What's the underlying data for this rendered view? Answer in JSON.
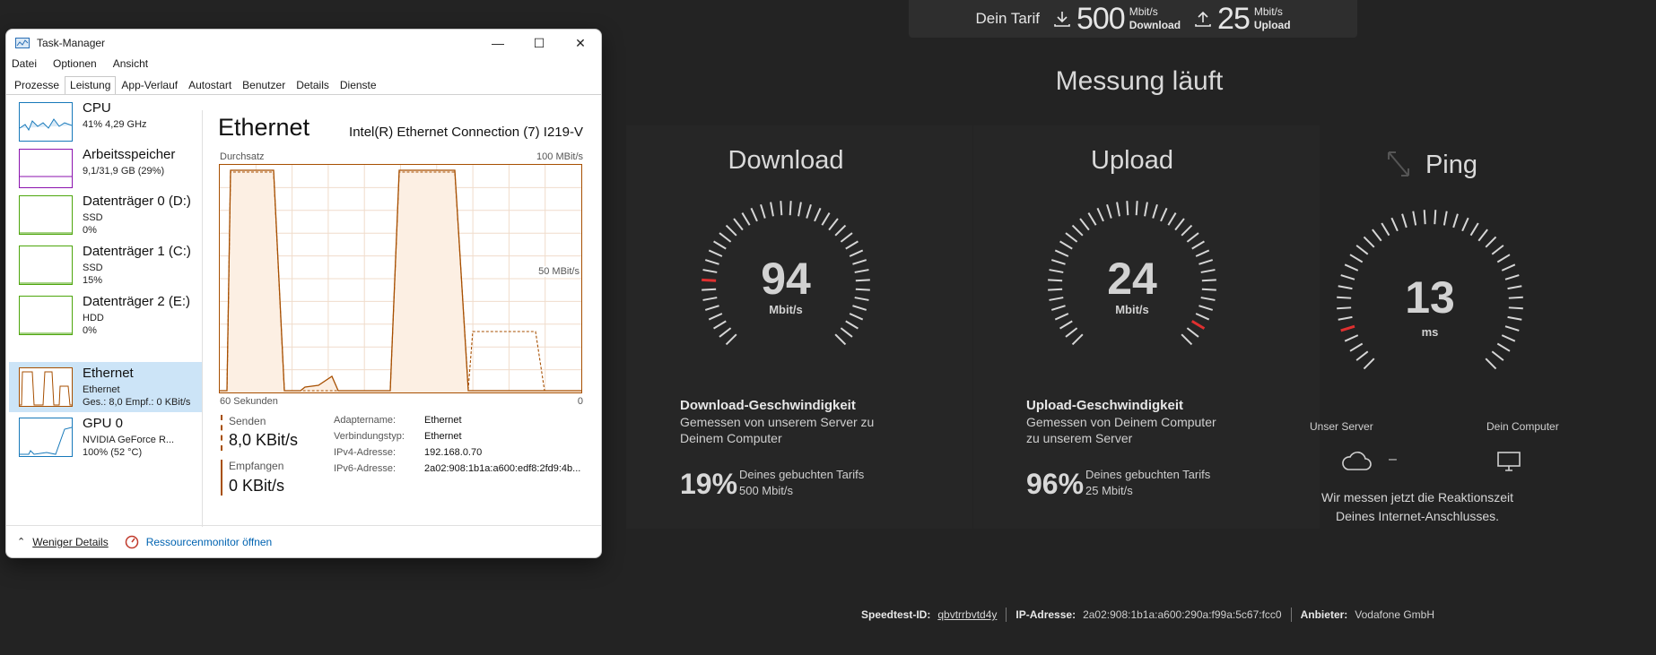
{
  "speedtest": {
    "tarif": {
      "label": "Dein Tarif",
      "download_value": "500",
      "download_unit": "Mbit/s",
      "download_label": "Download",
      "upload_value": "25",
      "upload_unit": "Mbit/s",
      "upload_label": "Upload"
    },
    "heading": "Messung läuft",
    "download": {
      "title": "Download",
      "value": "94",
      "unit": "Mbit/s",
      "desc_title": "Download-Geschwindigkeit",
      "desc_text": "Gemessen von unserem Server zu Deinem Computer",
      "percent": "19%",
      "percent_text1": "Deines gebuchten Tarifs",
      "percent_text2": "500 Mbit/s",
      "gauge_fraction": 0.19
    },
    "upload": {
      "title": "Upload",
      "value": "24",
      "unit": "Mbit/s",
      "desc_title": "Upload-Geschwindigkeit",
      "desc_text": "Gemessen von Deinem Computer zu unserem Server",
      "percent": "96%",
      "percent_text1": "Deines gebuchten Tarifs",
      "percent_text2": "25 Mbit/s",
      "gauge_fraction": 0.96
    },
    "ping": {
      "title": "Ping",
      "value": "13",
      "unit": "ms",
      "server_label": "Unser Server",
      "computer_label": "Dein Computer",
      "connector": "–",
      "message_line1": "Wir messen jetzt die Reaktionszeit",
      "message_line2": "Deines Internet-Anschlusses.",
      "gauge_fraction": 0.1
    },
    "footer": {
      "id_label": "Speedtest-ID:",
      "id_value": "qbvtrrbvtd4y",
      "ip_label": "IP-Adresse:",
      "ip_value": "2a02:908:1b1a:a600:290a:f99a:5c67:fcc0",
      "provider_label": "Anbieter:",
      "provider_value": "Vodafone GmbH"
    },
    "accent_color": "#e03030"
  },
  "taskmanager": {
    "title": "Task-Manager",
    "menu": [
      "Datei",
      "Optionen",
      "Ansicht"
    ],
    "tabs": [
      "Prozesse",
      "Leistung",
      "App-Verlauf",
      "Autostart",
      "Benutzer",
      "Details",
      "Dienste"
    ],
    "active_tab": "Leistung",
    "sidebar": [
      {
        "name": "CPU",
        "sub1": "41% 4,29 GHz",
        "sub2": "",
        "sub3": "",
        "color": "#1779ba"
      },
      {
        "name": "Arbeitsspeicher",
        "sub1": "9,1/31,9 GB (29%)",
        "sub2": "",
        "sub3": "",
        "color": "#8b12ae"
      },
      {
        "name": "Datenträger 0 (D:)",
        "sub1": "SSD",
        "sub2": "0%",
        "sub3": "",
        "color": "#4da60c"
      },
      {
        "name": "Datenträger 1 (C:)",
        "sub1": "SSD",
        "sub2": "15%",
        "sub3": "",
        "color": "#4da60c"
      },
      {
        "name": "Datenträger 2 (E:)",
        "sub1": "HDD",
        "sub2": "0%",
        "sub3": "",
        "color": "#4da60c"
      },
      {
        "name": "Ethernet",
        "sub1": "Ethernet",
        "sub2": "Ges.: 8,0 Empf.: 0 KBit/s",
        "sub3": "",
        "color": "#a74f01"
      },
      {
        "name": "GPU 0",
        "sub1": "NVIDIA GeForce R...",
        "sub2": "100% (52 °C)",
        "sub3": "",
        "color": "#1779ba"
      }
    ],
    "selected_index": 5,
    "detail": {
      "title": "Ethernet",
      "model": "Intel(R) Ethernet Connection (7) I219-V",
      "throughput_label": "Durchsatz",
      "max_label": "100 MBit/s",
      "mid_label": "50 MBit/s",
      "time_label": "60 Sekunden",
      "zero_label": "0",
      "send_label": "Senden",
      "send_value": "8,0 KBit/s",
      "recv_label": "Empfangen",
      "recv_value": "0 KBit/s",
      "adapter_label": "Adaptername:",
      "adapter_value": "Ethernet",
      "conn_label": "Verbindungstyp:",
      "conn_value": "Ethernet",
      "ipv4_label": "IPv4-Adresse:",
      "ipv4_value": "192.168.0.70",
      "ipv6_label": "IPv6-Adresse:",
      "ipv6_value": "2a02:908:1b1a:a600:edf8:2fd9:4b..."
    },
    "bottom": {
      "less_details": "Weniger Details",
      "resmon": "Ressourcenmonitor öffnen"
    }
  }
}
